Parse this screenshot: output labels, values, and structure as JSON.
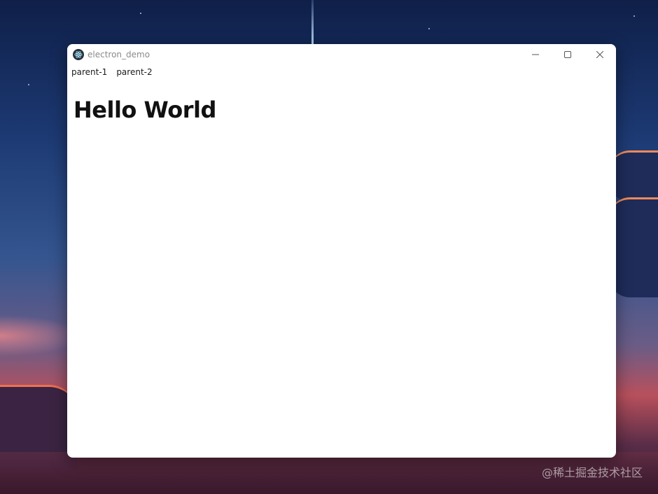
{
  "window": {
    "title": "electron_demo",
    "controls": {
      "minimize_icon": "minimize-icon",
      "maximize_icon": "maximize-icon",
      "close_icon": "close-icon"
    }
  },
  "menu": {
    "items": [
      {
        "label": "parent-1"
      },
      {
        "label": "parent-2"
      }
    ]
  },
  "content": {
    "heading": "Hello World"
  },
  "watermark": "@稀土掘金技术社区",
  "colors": {
    "window_bg": "#ffffff",
    "title_text": "#8a8a8a",
    "heading_text": "#111111"
  }
}
